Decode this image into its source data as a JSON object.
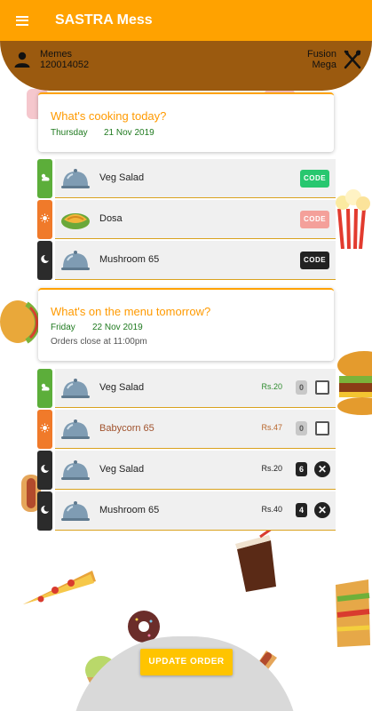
{
  "app": {
    "title": "SASTRA Mess"
  },
  "user": {
    "name": "Memes",
    "id": "120014052",
    "mess_line1": "Fusion",
    "mess_line2": "Mega"
  },
  "today": {
    "heading": "What's cooking today?",
    "day": "Thursday",
    "date": "21 Nov 2019",
    "meals": [
      {
        "slot": "breakfast",
        "icon": "cloud-sun-icon",
        "dish": "Veg Salad",
        "dish_icon": "cloche-icon",
        "code_label": "CODE",
        "code_color": "#28c76f"
      },
      {
        "slot": "lunch",
        "icon": "sun-icon",
        "dish": "Dosa",
        "dish_icon": "dosa-icon",
        "code_label": "CODE",
        "code_color": "#f4a09a"
      },
      {
        "slot": "dinner",
        "icon": "moon-icon",
        "dish": "Mushroom 65",
        "dish_icon": "cloche-icon",
        "code_label": "CODE",
        "code_color": "#222222"
      }
    ]
  },
  "tomorrow": {
    "heading": "What's on the menu tomorrow?",
    "day": "Friday",
    "date": "22 Nov 2019",
    "note": "Orders close at 11:00pm",
    "meals": [
      {
        "slot": "breakfast",
        "icon": "cloud-sun-icon",
        "dish": "Veg Salad",
        "price": "Rs.20",
        "qty": "0",
        "selected": false,
        "price_color": "#2e8b2e"
      },
      {
        "slot": "lunch",
        "icon": "sun-icon",
        "dish": "Babycorn 65",
        "price": "Rs.47",
        "qty": "0",
        "selected": false,
        "price_color": "#b8652a"
      },
      {
        "slot": "dinner",
        "icon": "moon-icon",
        "dish": "Veg Salad",
        "price": "Rs.20",
        "qty": "6",
        "selected": true,
        "price_color": "#222222"
      },
      {
        "slot": "dinner",
        "icon": "moon-icon",
        "dish": "Mushroom 65",
        "price": "Rs.40",
        "qty": "4",
        "selected": true,
        "price_color": "#222222"
      }
    ]
  },
  "actions": {
    "update_label": "UPDATE ORDER"
  },
  "colors": {
    "accent": "#ffa200",
    "breakfast": "#5cae3a",
    "lunch": "#f07a2a",
    "dinner": "#2b2b2b",
    "brown": "#9b5a0f"
  }
}
